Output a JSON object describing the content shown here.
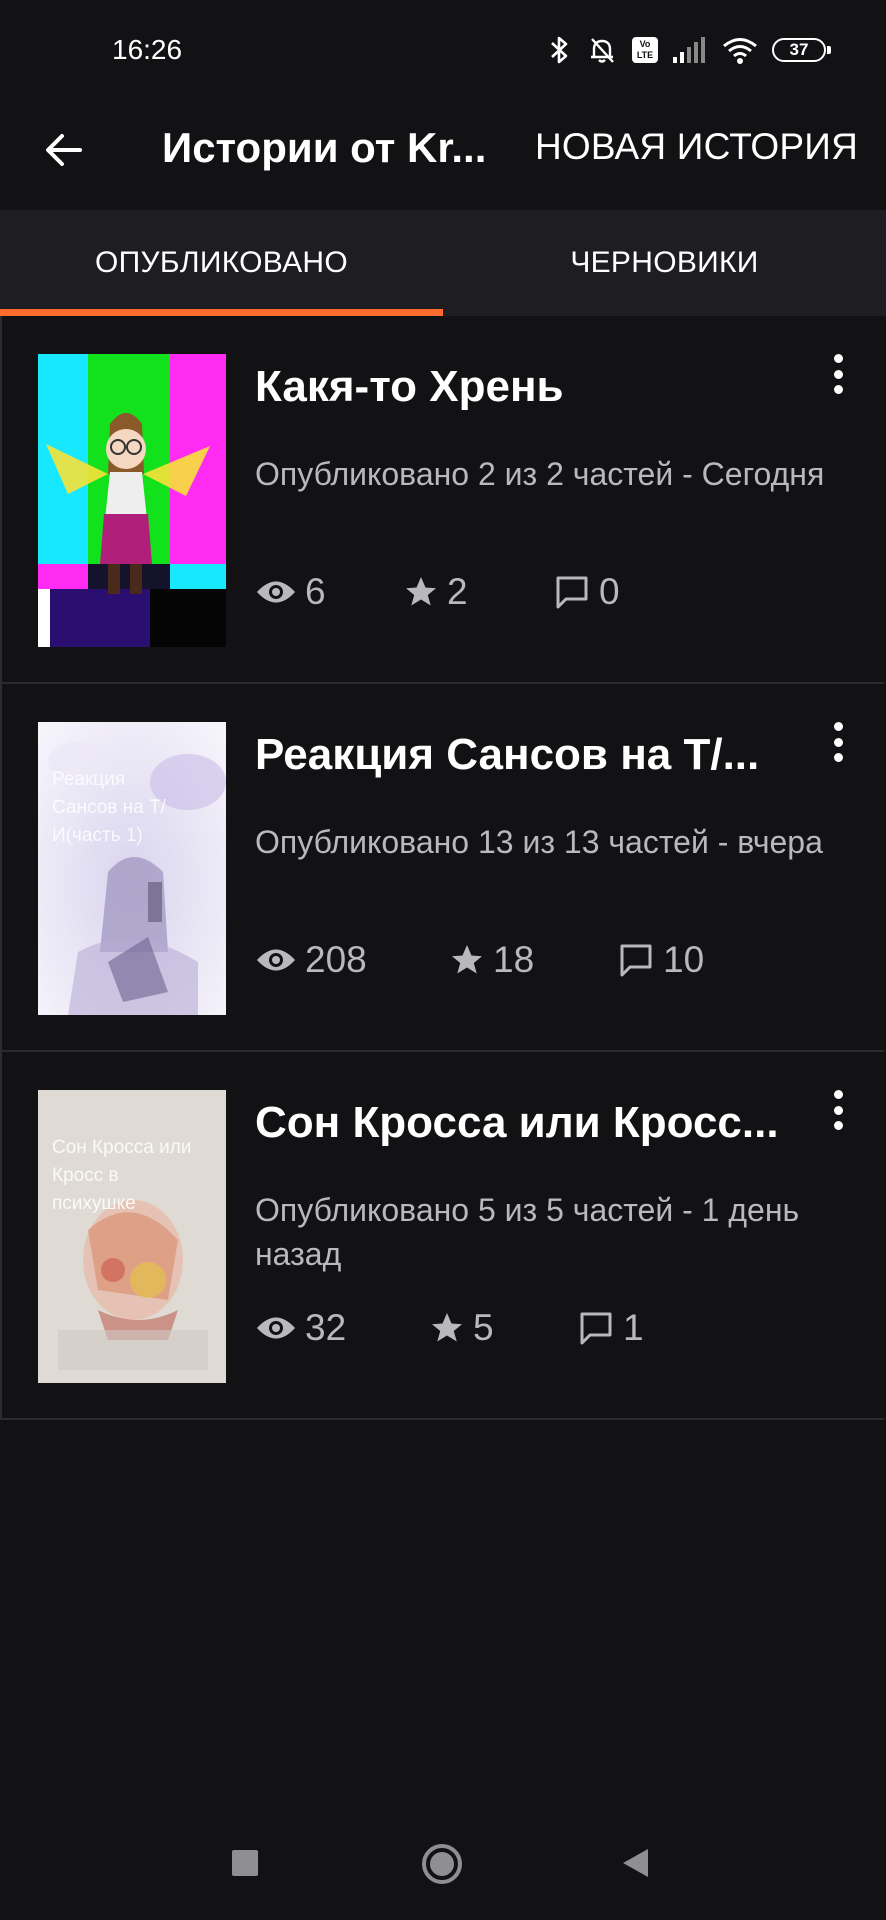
{
  "status_bar": {
    "time": "16:26",
    "battery": "37",
    "volte": "Vo LTE"
  },
  "app_bar": {
    "title": "Истории от Kr...",
    "new_story_label": "НОВАЯ ИСТОРИЯ"
  },
  "tabs": [
    {
      "label": "ОПУБЛИКОВАНО",
      "active": true
    },
    {
      "label": "ЧЕРНОВИКИ",
      "active": false
    }
  ],
  "stories": [
    {
      "title": "Какя-то Хрень",
      "meta": "Опубликовано 2 из 2 частей - Сегодня",
      "views": "6",
      "votes": "2",
      "comments": "0",
      "cover_text": ""
    },
    {
      "title": "Реакция Сансов на Т/...",
      "meta": "Опубликовано 13 из 13 частей - вчера",
      "views": "208",
      "votes": "18",
      "comments": "10",
      "cover_text": "Реакция Сансов на Т/И(часть 1)"
    },
    {
      "title": " Сон Кросса или Кросс...",
      "meta": "Опубликовано 5 из 5 частей - 1 день назад",
      "views": "32",
      "votes": "5",
      "comments": "1",
      "cover_text": " Сон Кросса или Кросс в психушке"
    }
  ],
  "colors": {
    "accent": "#ff6b2c",
    "background": "#121114",
    "tabbar": "#1e1d21",
    "secondary_text": "#b9b8bc"
  }
}
